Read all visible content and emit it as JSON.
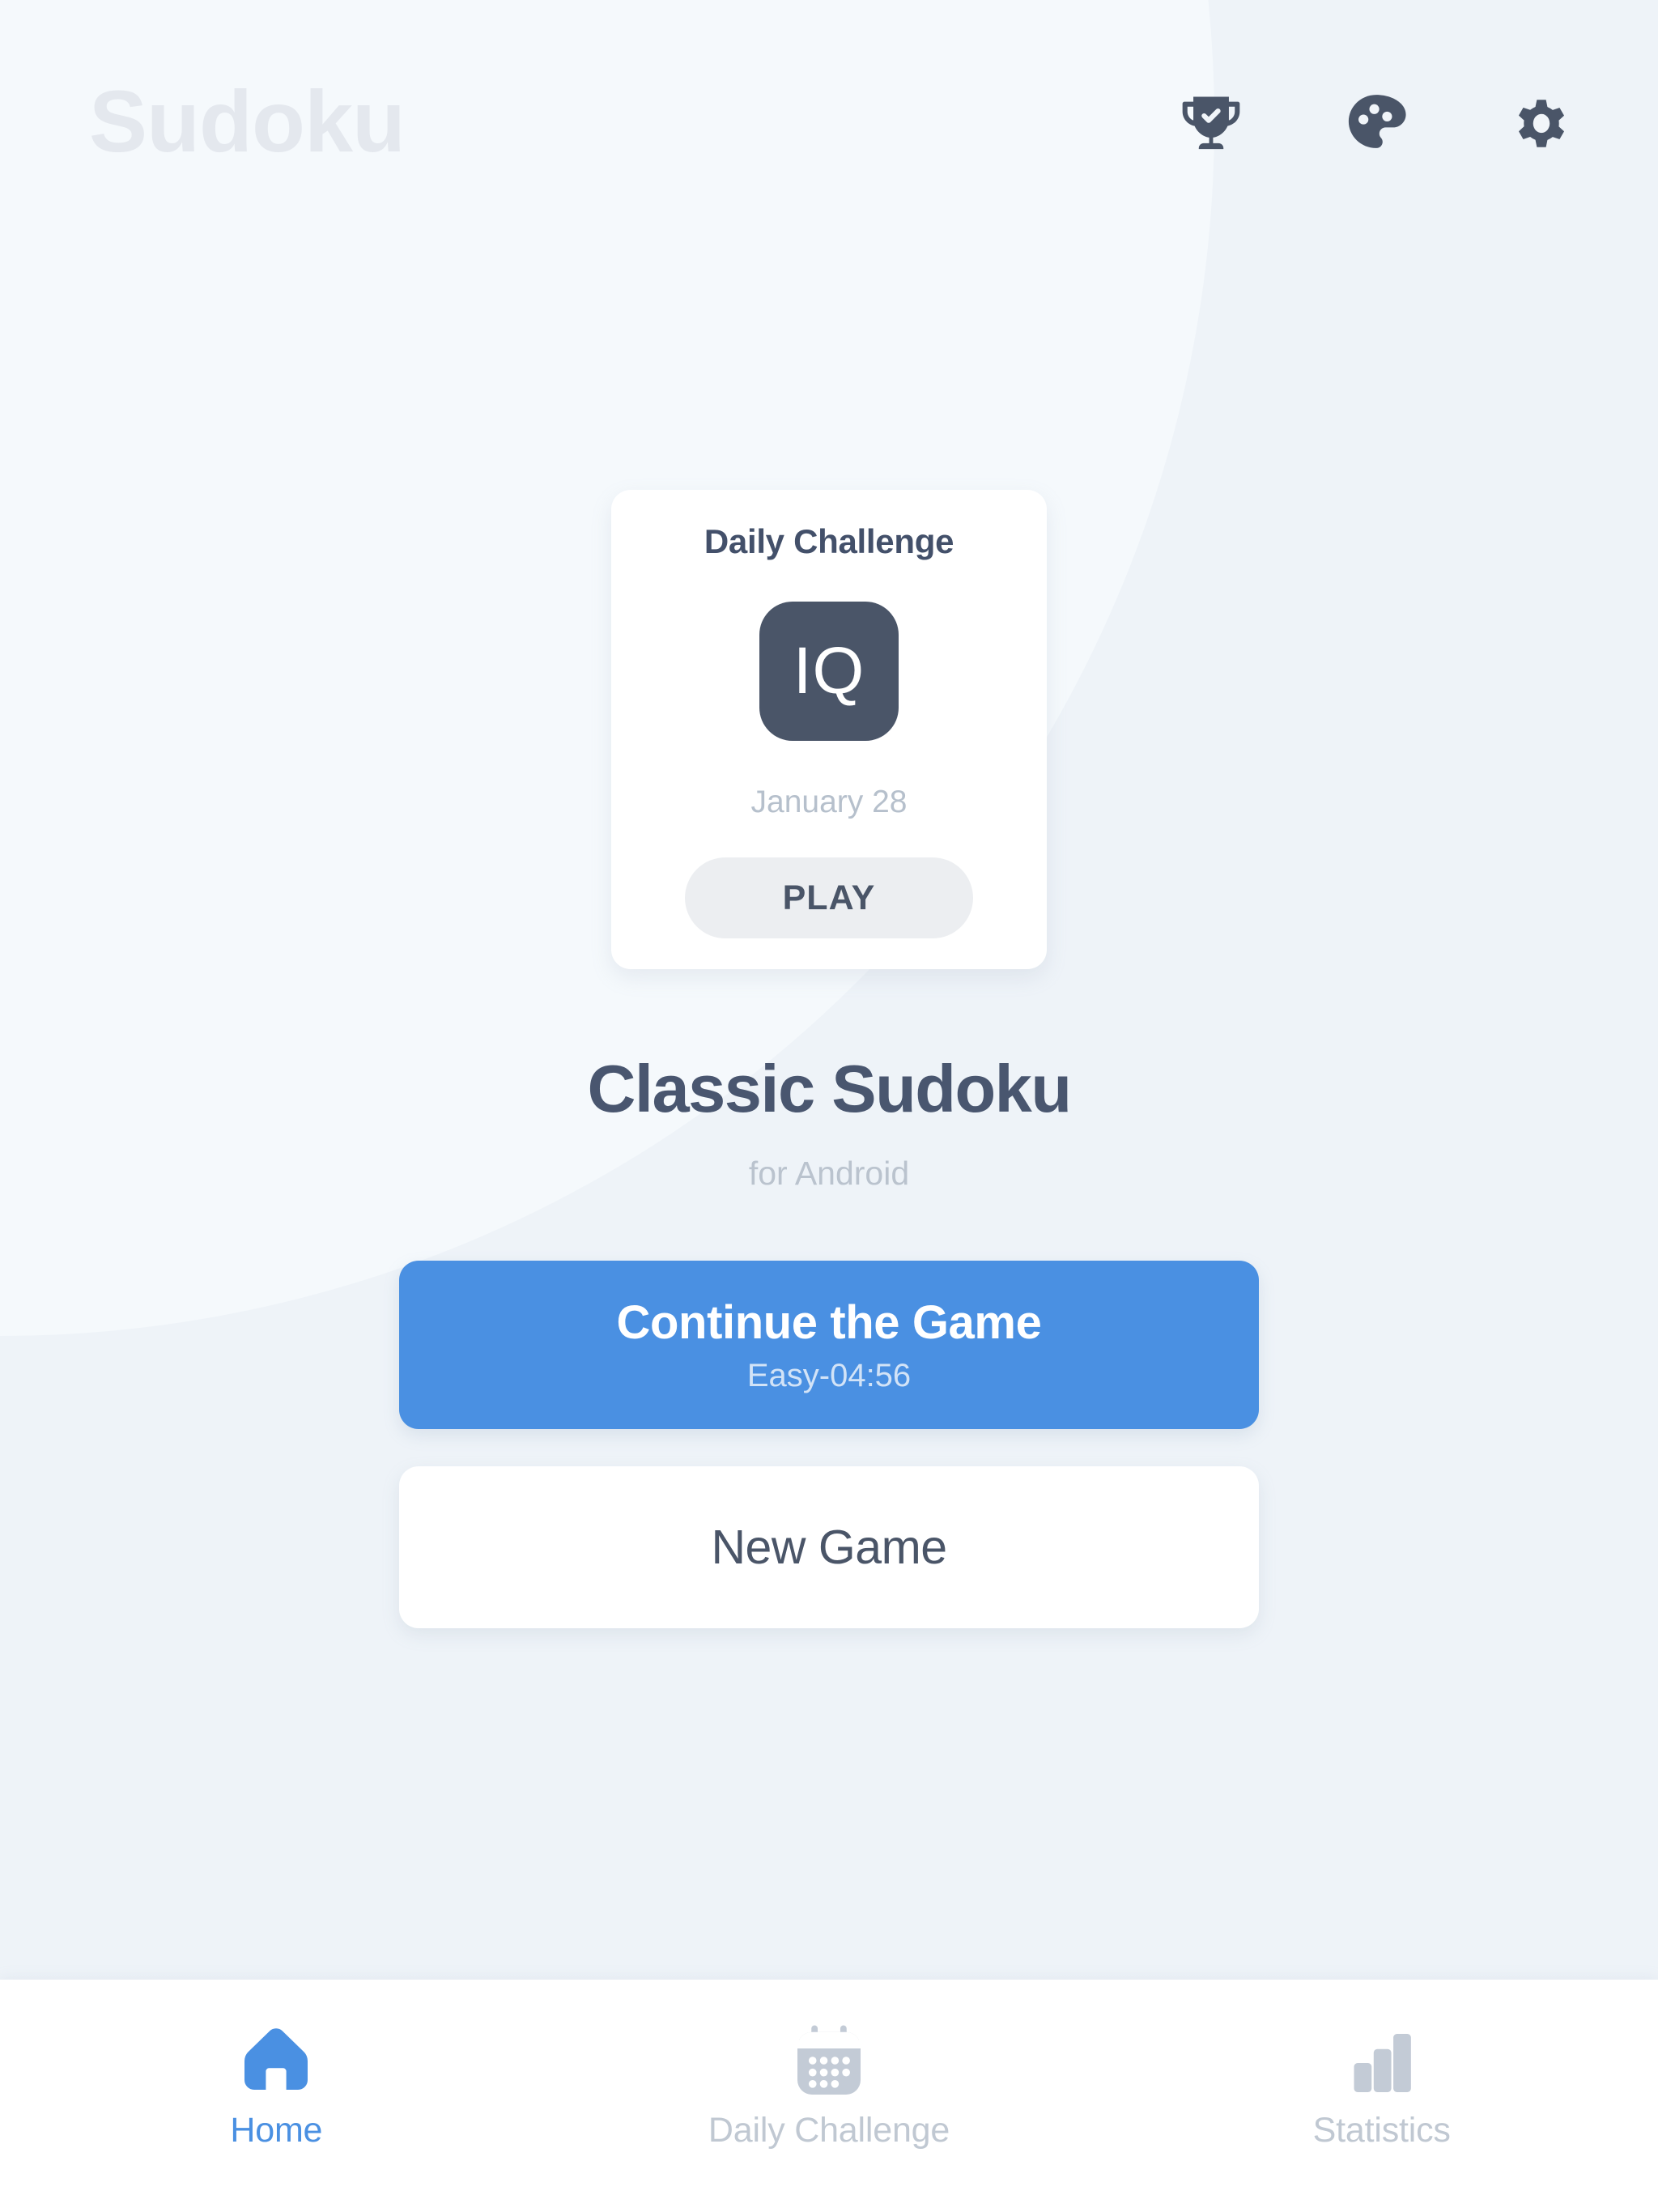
{
  "app": {
    "wordmark": "Sudoku",
    "background_color": "#eef3f8",
    "accent_color": "#4a90e2",
    "dark_color": "#4a5568",
    "muted_color": "#bac3ce"
  },
  "header": {
    "actions": [
      {
        "name": "trophy-icon",
        "label": "Achievements"
      },
      {
        "name": "palette-icon",
        "label": "Themes"
      },
      {
        "name": "gear-icon",
        "label": "Settings"
      }
    ]
  },
  "daily_card": {
    "title": "Daily Challenge",
    "badge_text": "IQ",
    "date": "January 28",
    "play_label": "PLAY"
  },
  "hero": {
    "title": "Classic Sudoku",
    "subtitle": "for Android"
  },
  "actions": {
    "continue_label": "Continue the Game",
    "continue_sub": "Easy-04:56",
    "new_game_label": "New Game"
  },
  "bottom_nav": {
    "items": [
      {
        "label": "Home",
        "icon": "home-icon",
        "active": true
      },
      {
        "label": "Daily Challenge",
        "icon": "calendar-icon",
        "active": false
      },
      {
        "label": "Statistics",
        "icon": "bar-chart-icon",
        "active": false
      }
    ]
  }
}
